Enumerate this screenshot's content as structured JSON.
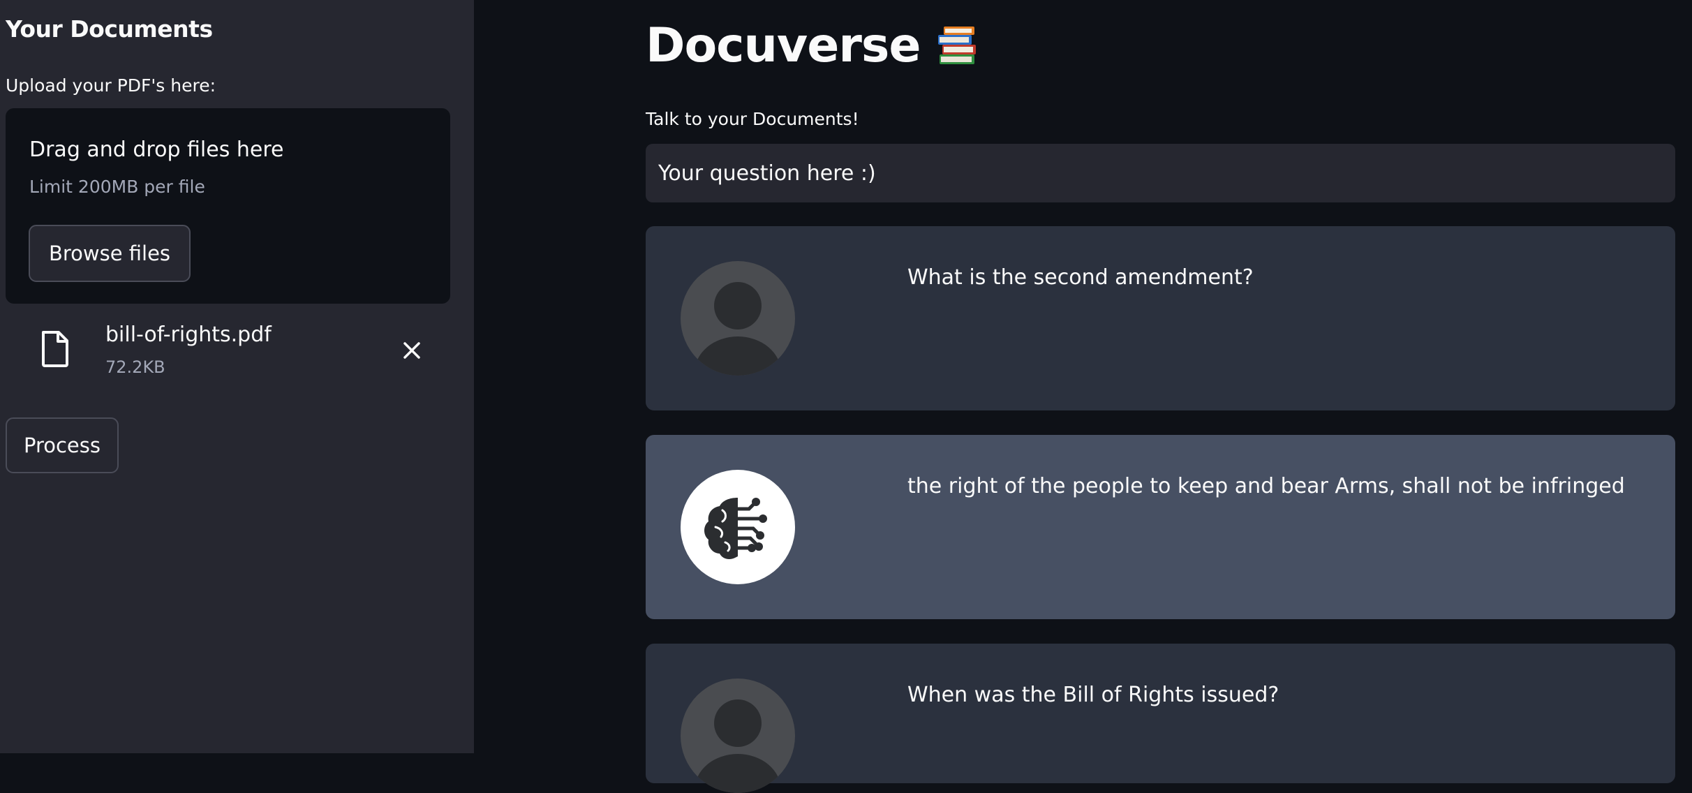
{
  "sidebar": {
    "title": "Your Documents",
    "upload_label": "Upload your PDF's here:",
    "dropzone": {
      "title": "Drag and drop files here",
      "limit": "Limit 200MB per file",
      "browse_label": "Browse files"
    },
    "file": {
      "name": "bill-of-rights.pdf",
      "size": "72.2KB",
      "icon": "file-icon",
      "remove_icon": "close-icon"
    },
    "process_label": "Process"
  },
  "main": {
    "title": "Docuverse",
    "title_icon": "books-emoji-icon",
    "subtitle": "Talk to your Documents!",
    "input": {
      "placeholder": "Your question here :)"
    },
    "messages": [
      {
        "role": "user",
        "avatar": "user-avatar-icon",
        "text": "What is the second amendment?"
      },
      {
        "role": "bot",
        "avatar": "brain-circuit-icon",
        "text": "the right of the people to keep and bear Arms, shall not be infringed"
      },
      {
        "role": "user",
        "avatar": "user-avatar-icon",
        "text": "When was the Bill of Rights issued?"
      }
    ]
  },
  "colors": {
    "app_background": "#0e1117",
    "sidebar_background": "#262730",
    "user_message": "#2b313e",
    "bot_message": "#475063",
    "text": "#fafafa"
  }
}
